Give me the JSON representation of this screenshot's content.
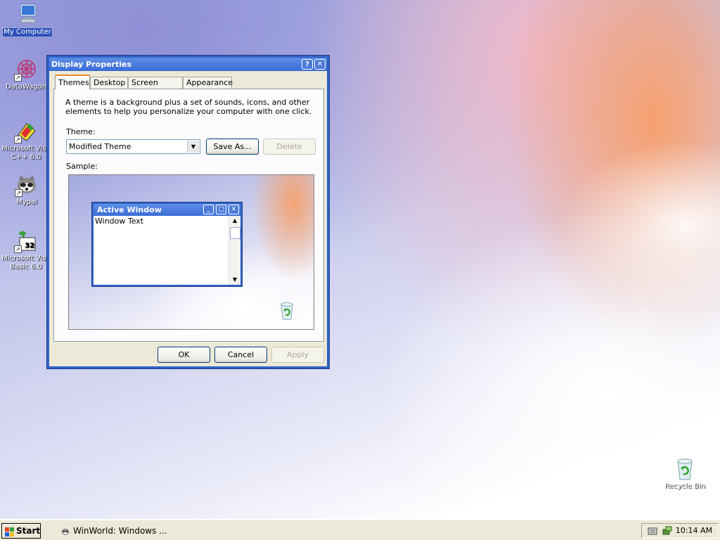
{
  "desktop": {
    "icons": [
      {
        "label": "My Computer"
      },
      {
        "label": "DataWagon"
      },
      {
        "label": "Microsoft Visu C++ 6.0"
      },
      {
        "label": "Mypal"
      },
      {
        "label": "Microsoft Visu Basic 6.0"
      },
      {
        "label": "Recycle Bin"
      }
    ]
  },
  "dialog": {
    "title": "Display Properties",
    "help_btn": "?",
    "close_btn": "✕",
    "tabs": [
      "Themes",
      "Desktop",
      "Screen Saver",
      "Appearance"
    ],
    "description": "A theme is a background plus a set of sounds, icons, and other elements to help you personalize your computer with one click.",
    "theme_label": "Theme:",
    "theme_value": "Modified Theme",
    "save_as": "Save As...",
    "delete": "Delete",
    "sample_label": "Sample:",
    "sample_window": {
      "title": "Active Window",
      "body": "Window Text"
    },
    "ok": "OK",
    "cancel": "Cancel",
    "apply": "Apply"
  },
  "taskbar": {
    "start": "Start",
    "task": "WinWorld: Windows ...",
    "clock": "10:14 AM"
  },
  "colors": {
    "accent": "#3163c5",
    "dialog_bg": "#ece9d8"
  }
}
